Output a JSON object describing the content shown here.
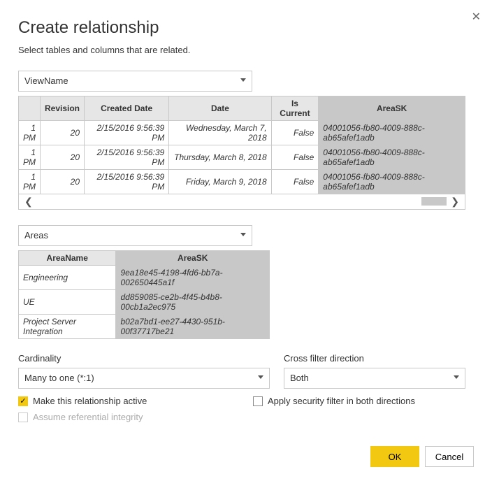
{
  "title": "Create relationship",
  "subtitle": "Select tables and columns that are related.",
  "close": "✕",
  "table1": {
    "dropdown": "ViewName",
    "headers": [
      "Revision",
      "Created Date",
      "Date",
      "Is Current",
      "AreaSK"
    ],
    "rows": [
      {
        "pm": "1 PM",
        "rev": "20",
        "created": "2/15/2016 9:56:39 PM",
        "date": "Wednesday, March 7, 2018",
        "cur": "False",
        "sk": "04001056-fb80-4009-888c-ab65afef1adb"
      },
      {
        "pm": "1 PM",
        "rev": "20",
        "created": "2/15/2016 9:56:39 PM",
        "date": "Thursday, March 8, 2018",
        "cur": "False",
        "sk": "04001056-fb80-4009-888c-ab65afef1adb"
      },
      {
        "pm": "1 PM",
        "rev": "20",
        "created": "2/15/2016 9:56:39 PM",
        "date": "Friday, March 9, 2018",
        "cur": "False",
        "sk": "04001056-fb80-4009-888c-ab65afef1adb"
      }
    ]
  },
  "table2": {
    "dropdown": "Areas",
    "headers": [
      "AreaName",
      "AreaSK"
    ],
    "rows": [
      {
        "name": "Engineering",
        "sk": "9ea18e45-4198-4fd6-bb7a-002650445a1f"
      },
      {
        "name": "UE",
        "sk": "dd859085-ce2b-4f45-b4b8-00cb1a2ec975"
      },
      {
        "name": "Project Server Integration",
        "sk": "b02a7bd1-ee27-4430-951b-00f37717be21"
      }
    ]
  },
  "cardinality": {
    "label": "Cardinality",
    "value": "Many to one (*:1)"
  },
  "crossfilter": {
    "label": "Cross filter direction",
    "value": "Both"
  },
  "checks": {
    "active": "Make this relationship active",
    "security": "Apply security filter in both directions",
    "integrity": "Assume referential integrity"
  },
  "buttons": {
    "ok": "OK",
    "cancel": "Cancel"
  }
}
